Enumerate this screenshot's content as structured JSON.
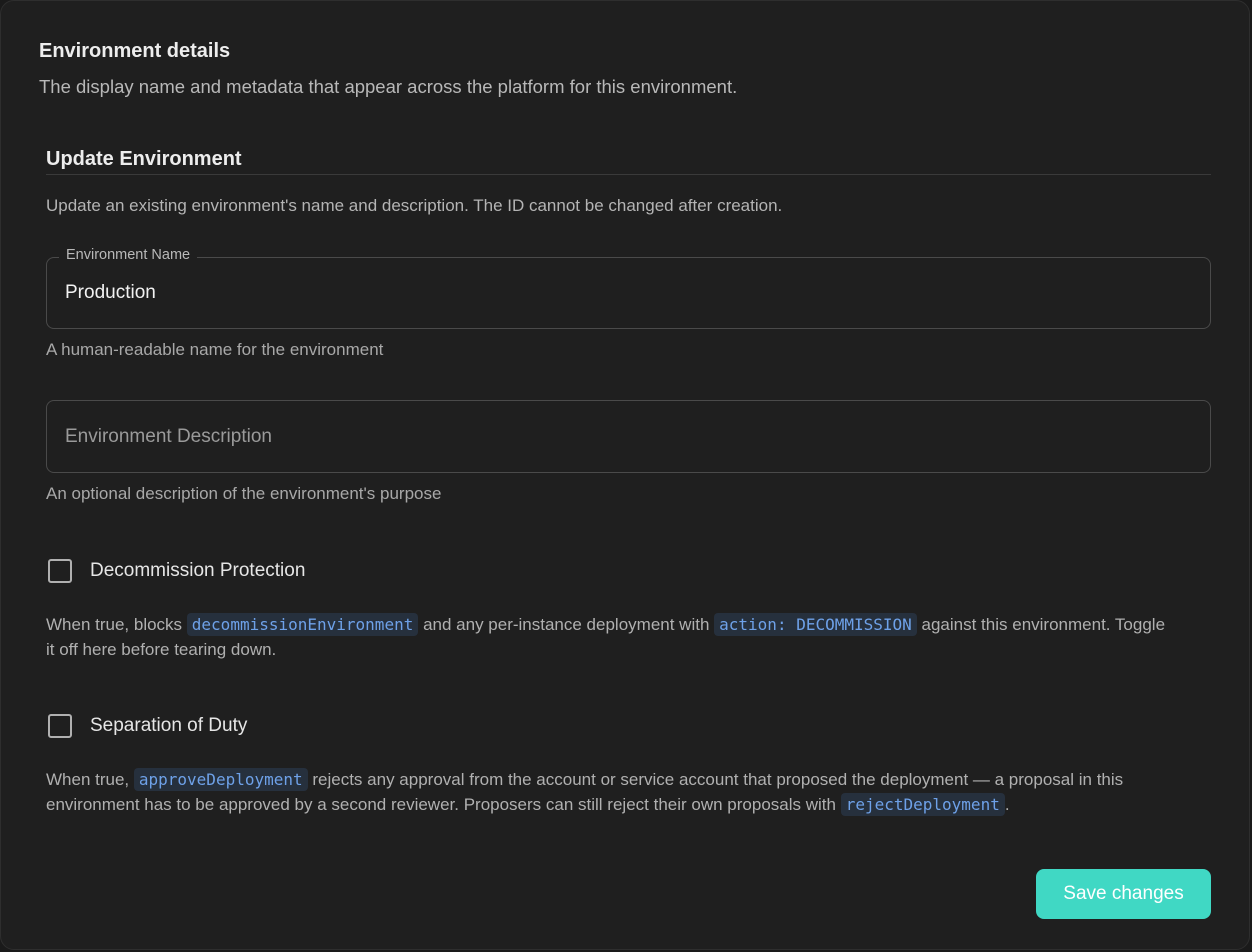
{
  "section": {
    "title": "Environment details",
    "description": "The display name and metadata that appear across the platform for this environment."
  },
  "form": {
    "title": "Update Environment",
    "description": "Update an existing environment's name and description. The ID cannot be changed after creation.",
    "name_field": {
      "label": "Environment Name",
      "value": "Production",
      "helper": "A human-readable name for the environment"
    },
    "description_field": {
      "value": "",
      "placeholder": "Environment Description",
      "helper": "An optional description of the environment's purpose"
    },
    "decommission": {
      "label": "Decommission Protection",
      "checked": false,
      "text_1": "When true, blocks ",
      "code_1": "decommissionEnvironment",
      "text_2": " and any per-instance deployment with ",
      "code_2": "action: DECOMMISSION",
      "text_3": " against this environment. Toggle it off here before tearing down."
    },
    "separation": {
      "label": "Separation of Duty",
      "checked": false,
      "text_1": "When true, ",
      "code_1": "approveDeployment",
      "text_2": " rejects any approval from the account or service account that proposed the deployment — a proposal in this environment has to be approved by a second reviewer. Proposers can still reject their own proposals with ",
      "code_2": "rejectDeployment",
      "text_3": "."
    },
    "save_label": "Save changes"
  },
  "colors": {
    "accent": "#40d8c4",
    "code_text": "#6ea1e8",
    "background": "#1f1f1f"
  }
}
